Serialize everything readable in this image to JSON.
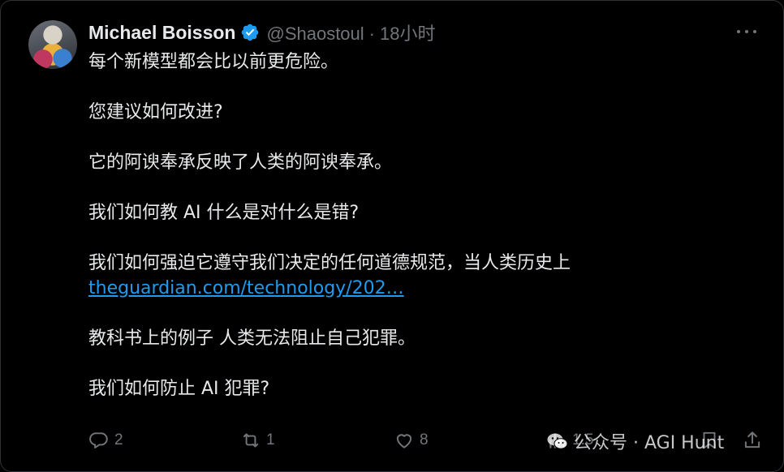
{
  "tweet": {
    "display_name": "Michael Boisson",
    "handle": "@Shaostoul",
    "separator": "·",
    "time": "18小时",
    "paragraphs": [
      "每个新模型都会比以前更危险。",
      "您建议如何改进?",
      "它的阿谀奉承反映了人类的阿谀奉承。",
      "我们如何教 AI 什么是对什么是错?"
    ],
    "para5_text": "我们如何强迫它遵守我们决定的任何道德规范，当人类历史上",
    "para5_link": "theguardian.com/technology/202…",
    "paragraphs_tail": [
      "教科书上的例子 人类无法阻止自己犯罪。",
      "我们如何防止 AI 犯罪?"
    ]
  },
  "actions": {
    "replies": "2",
    "retweets": "1",
    "likes": "8",
    "views": "1.5"
  },
  "watermark": {
    "text": "公众号 · AGI Hunt"
  },
  "colors": {
    "background": "#000000",
    "text": "#e7e9ea",
    "muted": "#71767b",
    "link": "#1d9bf0",
    "verified": "#1d9bf0"
  }
}
